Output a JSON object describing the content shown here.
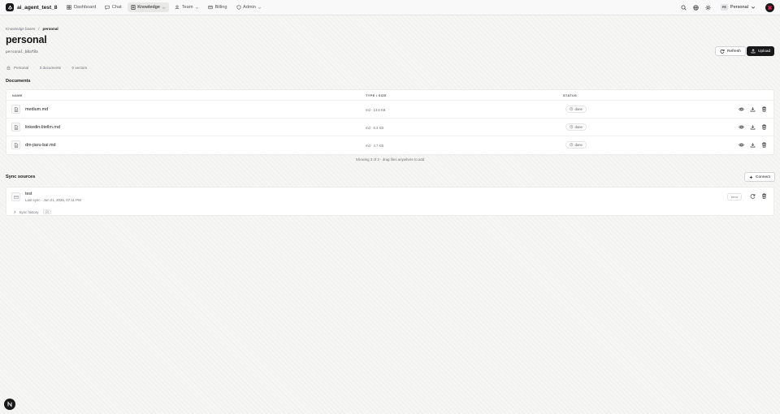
{
  "nav": {
    "brand": "ai_agent_test_8",
    "items": [
      {
        "label": "Dashboard",
        "icon": "grid-icon"
      },
      {
        "label": "Chat",
        "icon": "chat-icon"
      },
      {
        "label": "Knowledge",
        "icon": "book-icon",
        "active": true
      },
      {
        "label": "Team",
        "icon": "team-icon"
      },
      {
        "label": "Billing",
        "icon": "card-icon"
      },
      {
        "label": "Admin",
        "icon": "shield-icon"
      }
    ],
    "workspace": {
      "badge": "PE",
      "label": "Personal"
    }
  },
  "breadcrumb": {
    "parent": "Knowledge bases",
    "separator": "/",
    "current": "personal"
  },
  "page": {
    "title": "personal",
    "slug": "personal_b8af8a"
  },
  "actions": {
    "refresh": "Refresh",
    "upload": "Upload"
  },
  "meta": {
    "owner": "Personal",
    "documents": "3 documents",
    "vectors": "0 vectors"
  },
  "documents": {
    "heading": "Documents",
    "columns": {
      "name": "NAME",
      "type_size": "TYPE / SIZE",
      "status": "STATUS"
    },
    "rows": [
      {
        "name": "medium.md",
        "type_size": "md · 13.6 KB",
        "status": "done"
      },
      {
        "name": "linkedin-litellm.md",
        "type_size": "md · 6.3 KB",
        "status": "done"
      },
      {
        "name": "dm-jiaru-bai.md",
        "type_size": "md · 4.7 KB",
        "status": "done"
      }
    ],
    "footer": "Showing 3 of 3 · drag files anywhere to add"
  },
  "sync": {
    "heading": "Sync sources",
    "connect": "Connect",
    "source": {
      "name": "test",
      "last_sync": "Last sync · Jun 21, 2026, 07:11 PM",
      "status": "error"
    },
    "history_label": "Sync history",
    "history_count": "(2)"
  },
  "colors": {
    "accent_dark": "#18181b",
    "border": "#e4e4e7",
    "muted": "#71717a",
    "avatar_mark": "#e11d48"
  }
}
